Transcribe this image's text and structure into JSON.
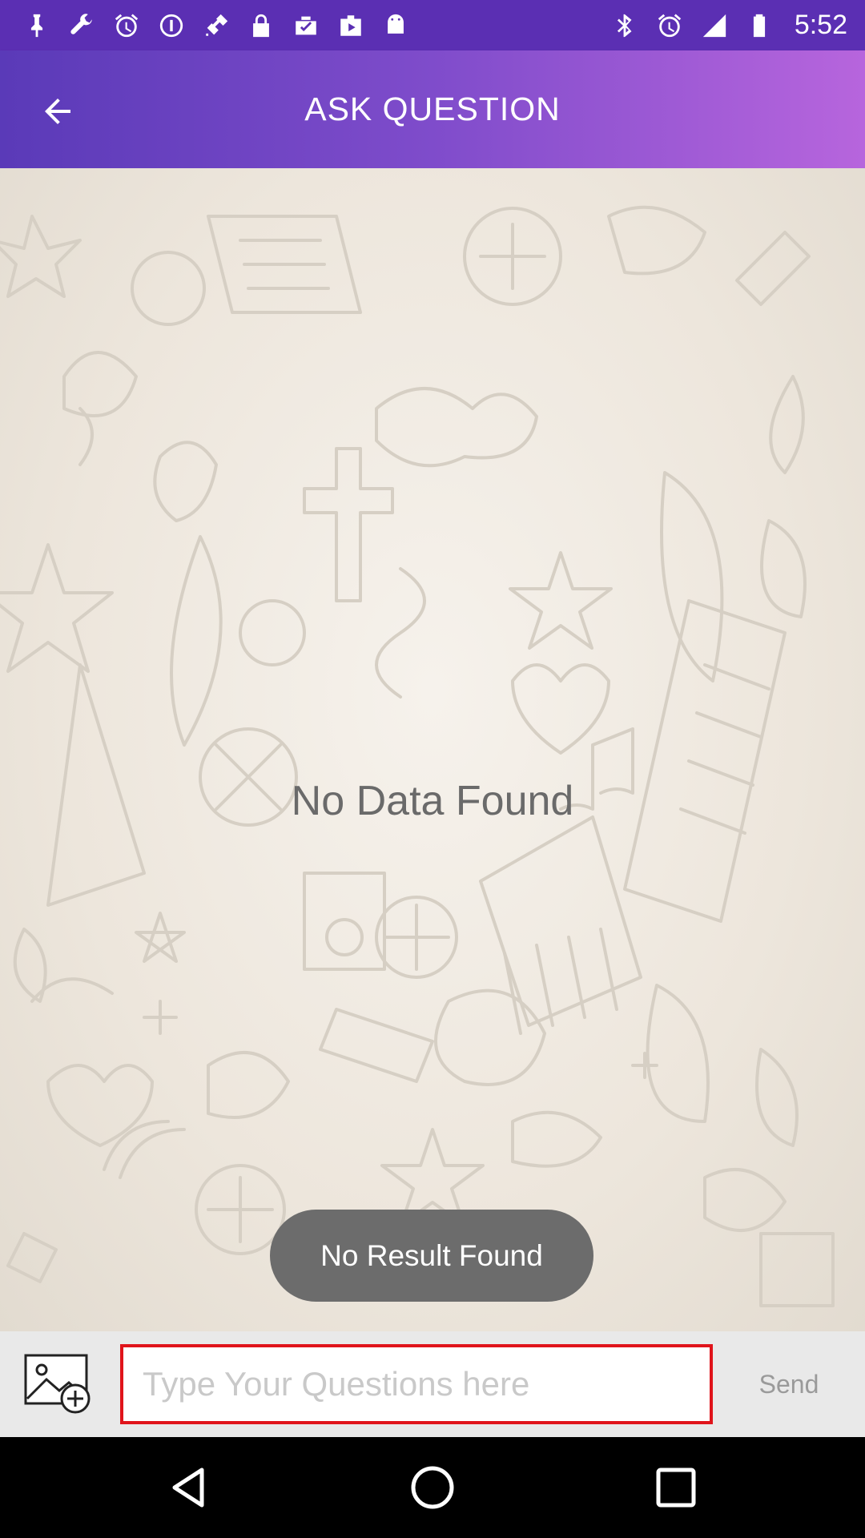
{
  "status_bar": {
    "time": "5:52",
    "left_icons": [
      "pin-icon",
      "wrench-icon",
      "alarm-icon",
      "info-circle-icon",
      "satellite-icon",
      "lock-icon",
      "clipboard-check-icon",
      "briefcase-play-icon",
      "android-icon"
    ],
    "right_icons": [
      "bluetooth-icon",
      "alarm-icon",
      "signal-icon",
      "battery-icon"
    ]
  },
  "app_bar": {
    "title": "ASK QUESTION",
    "back_icon": "arrow-left-icon"
  },
  "content": {
    "empty_message": "No Data Found"
  },
  "toast": {
    "message": "No Result Found"
  },
  "composer": {
    "image_icon": "add-image-icon",
    "placeholder": "Type Your Questions here",
    "value": "",
    "send_label": "Send"
  },
  "nav_bar": {
    "icons": [
      "back-triangle-icon",
      "home-circle-icon",
      "recents-square-icon"
    ]
  },
  "colors": {
    "status_bar": "#5b2fb3",
    "app_bar_start": "#5a3ab8",
    "app_bar_end": "#b765dd",
    "input_border": "#e0141b",
    "toast_bg": "#6c6c6c"
  }
}
